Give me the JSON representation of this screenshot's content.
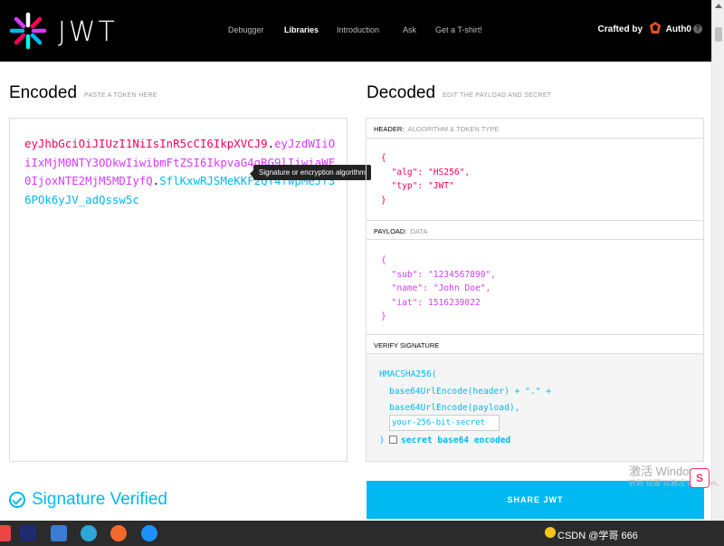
{
  "header": {
    "logo_text": "JWT",
    "nav": [
      {
        "label": "Debugger",
        "active": false
      },
      {
        "label": "Libraries",
        "active": true
      },
      {
        "label": "Introduction",
        "active": false
      },
      {
        "label": "Ask",
        "active": false
      },
      {
        "label": "Get a T-shirt!",
        "active": false
      }
    ],
    "crafted_by": "Crafted by",
    "brand": "Auth0",
    "help_icon": "?"
  },
  "encoded": {
    "title": "Encoded",
    "subtitle": "PASTE A TOKEN HERE",
    "token_header": "eyJhbGciOiJIUzI1NiIsInR5cCI6IkpXVCJ9",
    "token_payload": "eyJzdWIiOiIxMjM0NTY3ODkwIiwibmFtZSI6IkpvaG4gRG9lIiwiaWF0IjoxNTE2MjM5MDIyfQ",
    "token_signature": "SflKxwRJSMeKKF2QT4fwpMeJf36POk6yJV_adQssw5c",
    "dot": ".",
    "tooltip": "Signature or encryption algorithm"
  },
  "decoded": {
    "title": "Decoded",
    "subtitle": "EDIT THE PAYLOAD AND SECRET",
    "header_label": "HEADER:",
    "header_sub": "ALGORITHM & TOKEN TYPE",
    "header_json": {
      "open": "{",
      "line1": "  \"alg\": \"HS256\",",
      "line2": "  \"typ\": \"JWT\"",
      "close": "}"
    },
    "payload_label": "PAYLOAD:",
    "payload_sub": "DATA",
    "payload_json": {
      "open": "{",
      "line1": "  \"sub\": \"1234567890\",",
      "line2": "  \"name\": \"John Doe\",",
      "line3": "  \"iat\": 1516239022",
      "close": "}"
    },
    "verify_label": "VERIFY SIGNATURE",
    "sig_line1": "HMACSHA256(",
    "sig_line2": "base64UrlEncode(header) + \".\" +",
    "sig_line3": "base64UrlEncode(payload),",
    "secret_value": "your-256-bit-secret",
    "sig_close": ")",
    "secret_b64_label": "secret base64 encoded"
  },
  "footer": {
    "verified": "Signature Verified",
    "share": "SHARE JWT"
  },
  "overlay": {
    "activate_title": "激活 Windows",
    "activate_sub": "转到\"设置\"以激活 Windows。",
    "ime": "S"
  },
  "taskbar": {
    "tray_text": "CSDN @学哥 666"
  },
  "colors": {
    "header_red": "#fb015b",
    "payload_purple": "#d63aff",
    "signature_cyan": "#00b9f1"
  }
}
